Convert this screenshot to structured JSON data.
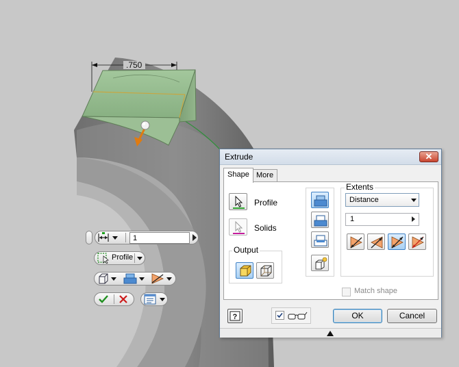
{
  "viewport": {
    "dimension_value": ".750"
  },
  "mini_toolbar": {
    "distance_value": "1",
    "profile_label": "Profile"
  },
  "dialog": {
    "title": "Extrude",
    "close_glyph": "✕",
    "tabs": [
      {
        "label": "Shape",
        "active": true
      },
      {
        "label": "More",
        "active": false
      }
    ],
    "profile_label": "Profile",
    "solids_label": "Solids",
    "output_title": "Output",
    "extents_title": "Extents",
    "extents_type": "Distance",
    "distance_value": "1",
    "match_shape_label": "Match shape",
    "match_shape_checked": false,
    "preview_checked": true,
    "ok_label": "OK",
    "cancel_label": "Cancel",
    "help_icon": "question-help-icon",
    "preview_icon": "glasses-icon",
    "expand_icon": "up-arrow-icon"
  },
  "colors": {
    "dialog_border": "#5f7a96",
    "active_button": "#a9d0f2",
    "close_button": "#c9452f",
    "model_green": "#9fc69a"
  }
}
